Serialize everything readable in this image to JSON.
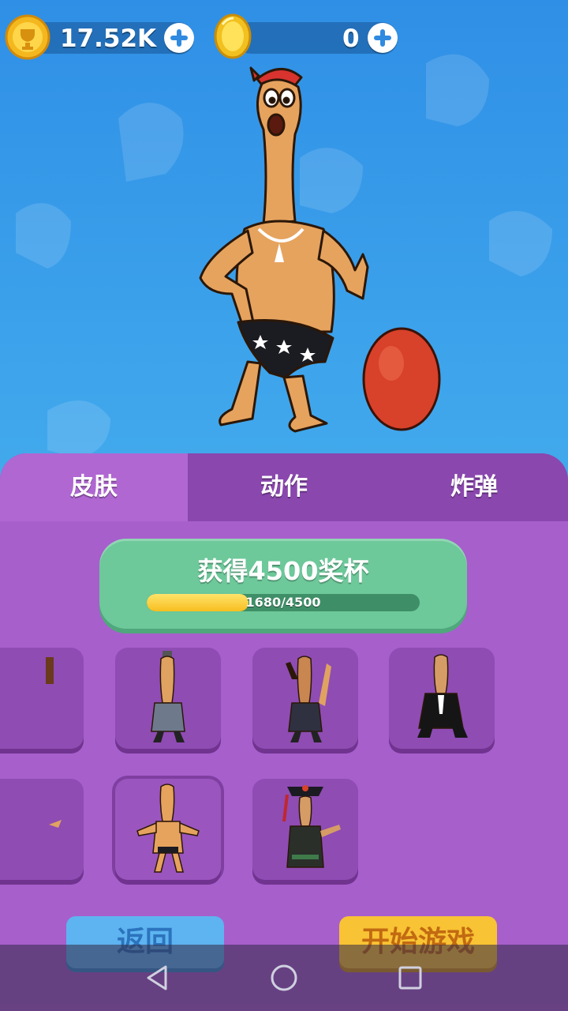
{
  "header": {
    "trophies_value": "17.52K",
    "coins_value": "0",
    "trophy_icon": "trophy-coin-icon",
    "coin_icon": "gold-coin-icon",
    "plus_icon": "plus-icon"
  },
  "tabs": [
    {
      "label": "皮肤",
      "active": true
    },
    {
      "label": "动作",
      "active": false
    },
    {
      "label": "炸弹",
      "active": false
    }
  ],
  "reward": {
    "title": "获得4500奖杯",
    "progress_text": "1680/4500",
    "progress_current": 1680,
    "progress_max": 4500
  },
  "skins": {
    "row1": [
      "skin-partial",
      "skin-gray-suit",
      "skin-dark-suit",
      "skin-black-suit"
    ],
    "row2": [
      "skin-partial",
      "skin-default-selected",
      "skin-qing-official"
    ]
  },
  "buttons": {
    "back": "返回",
    "start": "开始游戏"
  },
  "colors": {
    "accent_purple": "#a75fcc",
    "tab_bar": "#8a47ae",
    "reward_green": "#6dc89a",
    "progress_yellow": "#f7be1f",
    "back_blue": "#5db4f0",
    "start_yellow": "#f8c334"
  }
}
